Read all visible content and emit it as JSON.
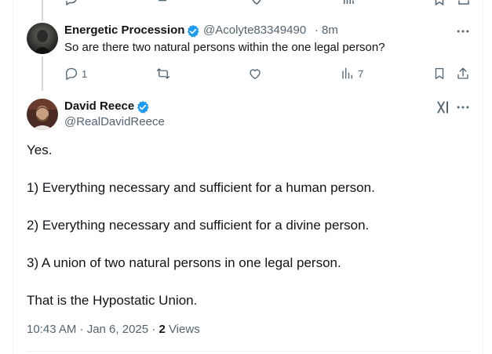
{
  "reply": {
    "display_name": "Energetic Procession",
    "handle": "@Acolyte83349490",
    "separator": "·",
    "time": "8m",
    "text": "So are there two natural persons within the one legal person?",
    "replies_count": "1",
    "views_count": "7"
  },
  "main": {
    "display_name": "David Reece",
    "handle": "@RealDavidReece",
    "paragraphs": [
      "Yes.",
      "1) Everything necessary and sufficient for a human person.",
      "2) Everything necessary and sufficient for a divine person.",
      "3) A union of two natural persons in one legal person.",
      "That is the Hypostatic Union."
    ],
    "timestamp": "10:43 AM · Jan 6, 2025 · ",
    "views_count": "2",
    "views_label": "Views"
  },
  "colors": {
    "verified": "#1d9bf0",
    "muted": "#536471",
    "text": "#0f1419"
  },
  "icons": [
    "reply-icon",
    "retweet-icon",
    "like-icon",
    "views-icon",
    "bookmark-icon",
    "share-icon",
    "more-icon",
    "grok-icon",
    "verified-badge-icon"
  ]
}
